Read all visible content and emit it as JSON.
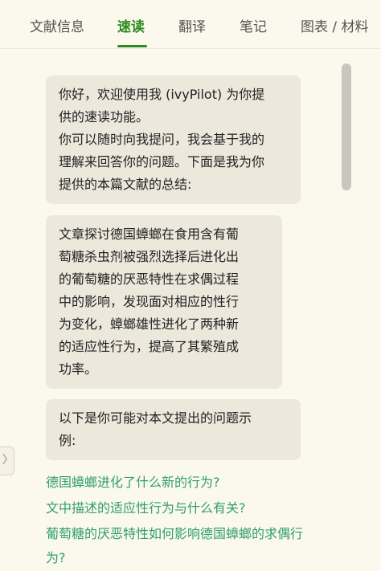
{
  "tabs": [
    {
      "label": "文献信息",
      "active": false
    },
    {
      "label": "速读",
      "active": true
    },
    {
      "label": "翻译",
      "active": false
    },
    {
      "label": "笔记",
      "active": false
    },
    {
      "label": "图表 / 材料",
      "active": false
    }
  ],
  "messages": {
    "greeting_line1": "你好，欢迎使用我 (ivyPilot) 为你提",
    "greeting_line2": "供的速读功能。",
    "greeting_line3": "你可以随时向我提问，我会基于我的",
    "greeting_line4": "理解来回答你的问题。下面是我为你",
    "greeting_line5": "提供的本篇文献的总结:",
    "summary_line1": "文章探讨德国蟑螂在食用含有葡",
    "summary_line2": "萄糖杀虫剂被强烈选择后进化出",
    "summary_line3": "的葡萄糖的厌恶特性在求偶过程",
    "summary_line4": "中的影响，发现面对相应的性行",
    "summary_line5": "为变化，蟑螂雄性进化了两种新",
    "summary_line6": "的适应性行为，提高了其繁殖成",
    "summary_line7": "功率。",
    "questions_intro_line1": "以下是你可能对本文提出的问题示",
    "questions_intro_line2": "例:"
  },
  "suggested_questions": {
    "q1": "德国蟑螂进化了什么新的行为?",
    "q2": "文中描述的适应性行为与什么有关?",
    "q3_line1": "葡萄糖的厌恶特性如何影响德国蟑螂的求偶行",
    "q3_line2": "为?"
  },
  "side_handle": {
    "icon": "chevron-right-icon",
    "glyph": "〉"
  },
  "colors": {
    "accent": "#2e8b1f",
    "link": "#2f9f6c",
    "bubble": "#ece8dc",
    "background": "#fbf8ee"
  }
}
